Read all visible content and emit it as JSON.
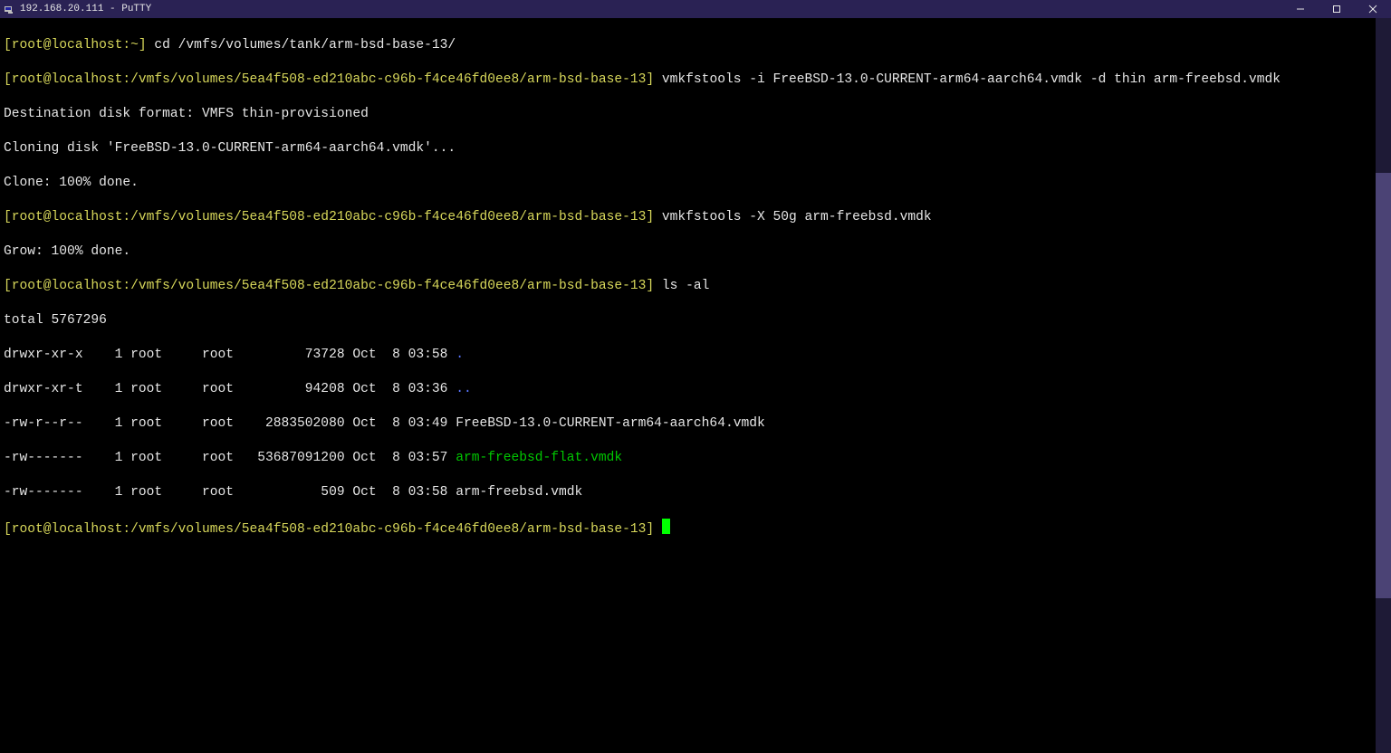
{
  "window": {
    "title": "192.168.20.111 - PuTTY"
  },
  "terminal": {
    "prompt_home": "[root@localhost:~]",
    "prompt_long": "[root@localhost:/vmfs/volumes/5ea4f508-ed210abc-c96b-f4ce46fd0ee8/arm-bsd-base-13]",
    "cmd1": " cd /vmfs/volumes/tank/arm-bsd-base-13/",
    "cmd2": " vmkfstools -i FreeBSD-13.0-CURRENT-arm64-aarch64.vmdk -d thin arm-freebsd.vmdk",
    "out2a": "Destination disk format: VMFS thin-provisioned",
    "out2b": "Cloning disk 'FreeBSD-13.0-CURRENT-arm64-aarch64.vmdk'...",
    "out2c": "Clone: 100% done.",
    "cmd3": " vmkfstools -X 50g arm-freebsd.vmdk",
    "out3a": "Grow: 100% done.",
    "cmd4": " ls -al",
    "ls_total": "total 5767296",
    "ls_row_dot_pre": "drwxr-xr-x    1 root     root         73728 Oct  8 03:58 ",
    "ls_row_dot_name": ".",
    "ls_row_dotdot_pre": "drwxr-xr-t    1 root     root         94208 Oct  8 03:36 ",
    "ls_row_dotdot_name": "..",
    "ls_row_vmdk1": "-rw-r--r--    1 root     root    2883502080 Oct  8 03:49 FreeBSD-13.0-CURRENT-arm64-aarch64.vmdk",
    "ls_row_vmdk2_pre": "-rw-------    1 root     root   53687091200 Oct  8 03:57 ",
    "ls_row_vmdk2_name": "arm-freebsd-flat.vmdk",
    "ls_row_vmdk3": "-rw-------    1 root     root           509 Oct  8 03:58 arm-freebsd.vmdk",
    "trailing_space": " "
  }
}
